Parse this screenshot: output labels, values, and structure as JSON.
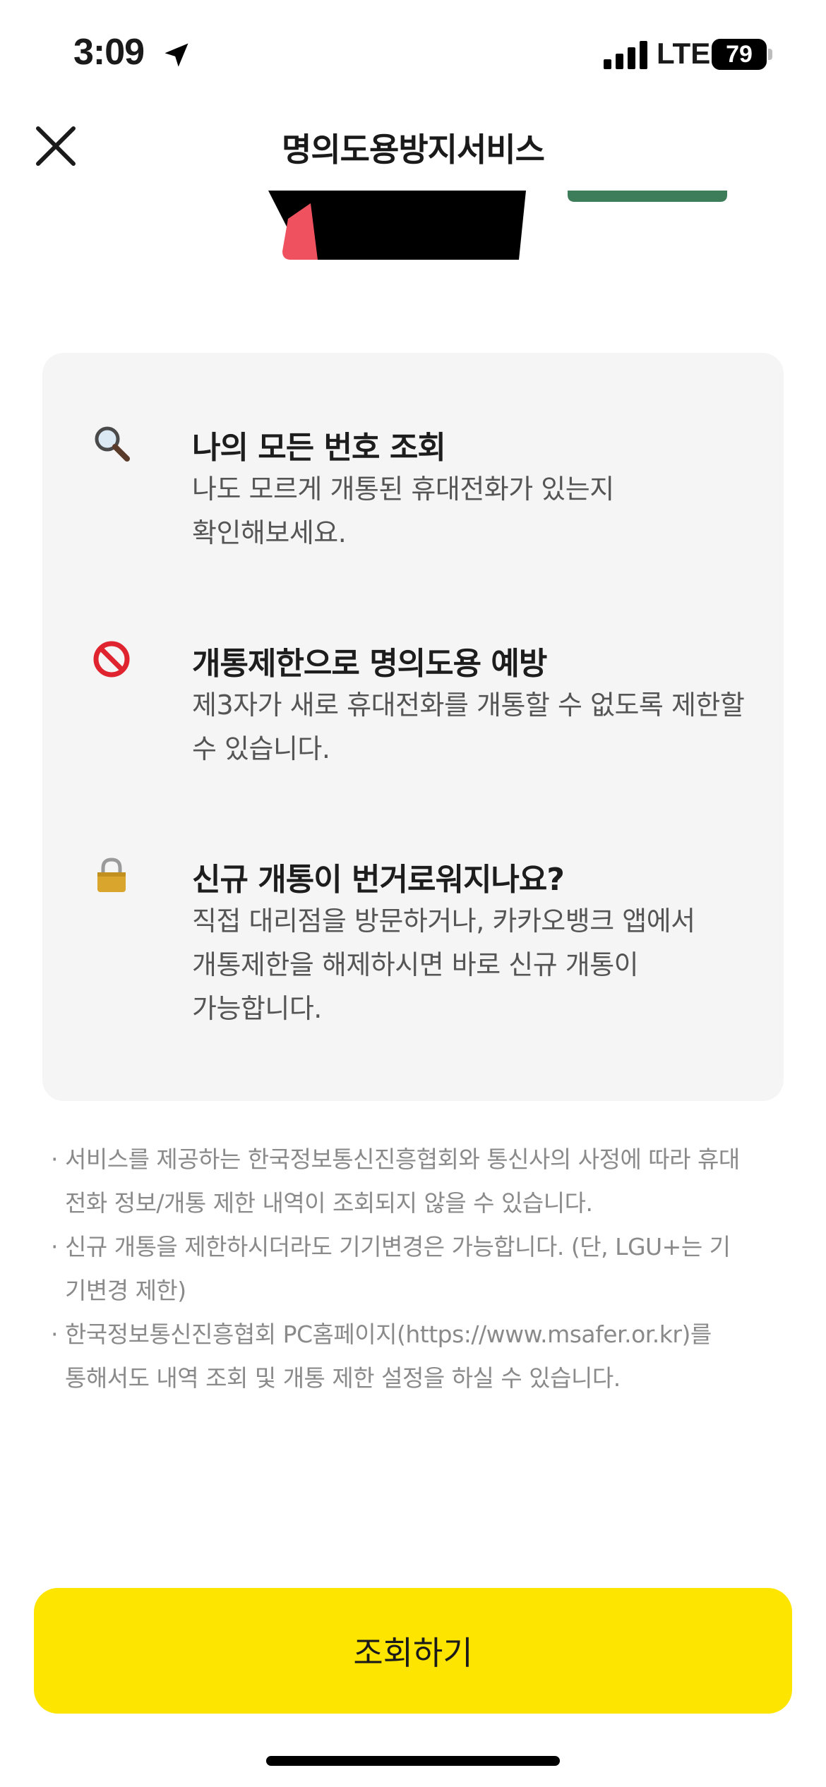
{
  "status_bar": {
    "time": "3:09",
    "network": "LTE",
    "battery_level": "79",
    "icons": [
      "location-arrow-icon",
      "signal-bars-icon",
      "battery-icon"
    ]
  },
  "nav": {
    "title": "명의도용방지서비스",
    "close_icon": "close-icon"
  },
  "features": [
    {
      "icon": "magnifier-icon",
      "title": "나의 모든 번호 조회",
      "desc_lines": [
        "나도 모르게 개통된 휴대전화가 있는지",
        "확인해보세요."
      ]
    },
    {
      "icon": "prohibited-icon",
      "title": "개통제한으로 명의도용 예방",
      "desc_lines": [
        "제3자가 새로 휴대전화를 개통할 수 없도록 제한할",
        "수 있습니다."
      ]
    },
    {
      "icon": "padlock-icon",
      "title": "신규 개통이 번거로워지나요?",
      "desc_lines": [
        "직접 대리점을 방문하거나, 카카오뱅크 앱에서",
        "개통제한을 해제하시면 바로 신규 개통이",
        "가능합니다."
      ]
    }
  ],
  "notices": [
    {
      "lines": [
        "서비스를 제공하는 한국정보통신진흥협회와 통신사의 사정에 따라 휴대",
        "전화 정보/개통 제한 내역이 조회되지 않을 수 있습니다."
      ]
    },
    {
      "lines": [
        "신규 개통을 제한하시더라도 기기변경은 가능합니다. (단, LGU+는 기",
        "기변경 제한)"
      ]
    },
    {
      "lines": [
        "한국정보통신진흥협회 PC홈페이지(https://www.msafer.or.kr)를",
        "통해서도 내역 조회 및 개통 제한 설정을 하실 수 있습니다."
      ]
    }
  ],
  "cta": {
    "label": "조회하기",
    "color": "#fee500"
  },
  "colors": {
    "card_background": "#f5f5f5",
    "notice_text": "#8a8a8a",
    "illustration_green": "#3e7d5a",
    "illustration_red": "#f0515f"
  }
}
